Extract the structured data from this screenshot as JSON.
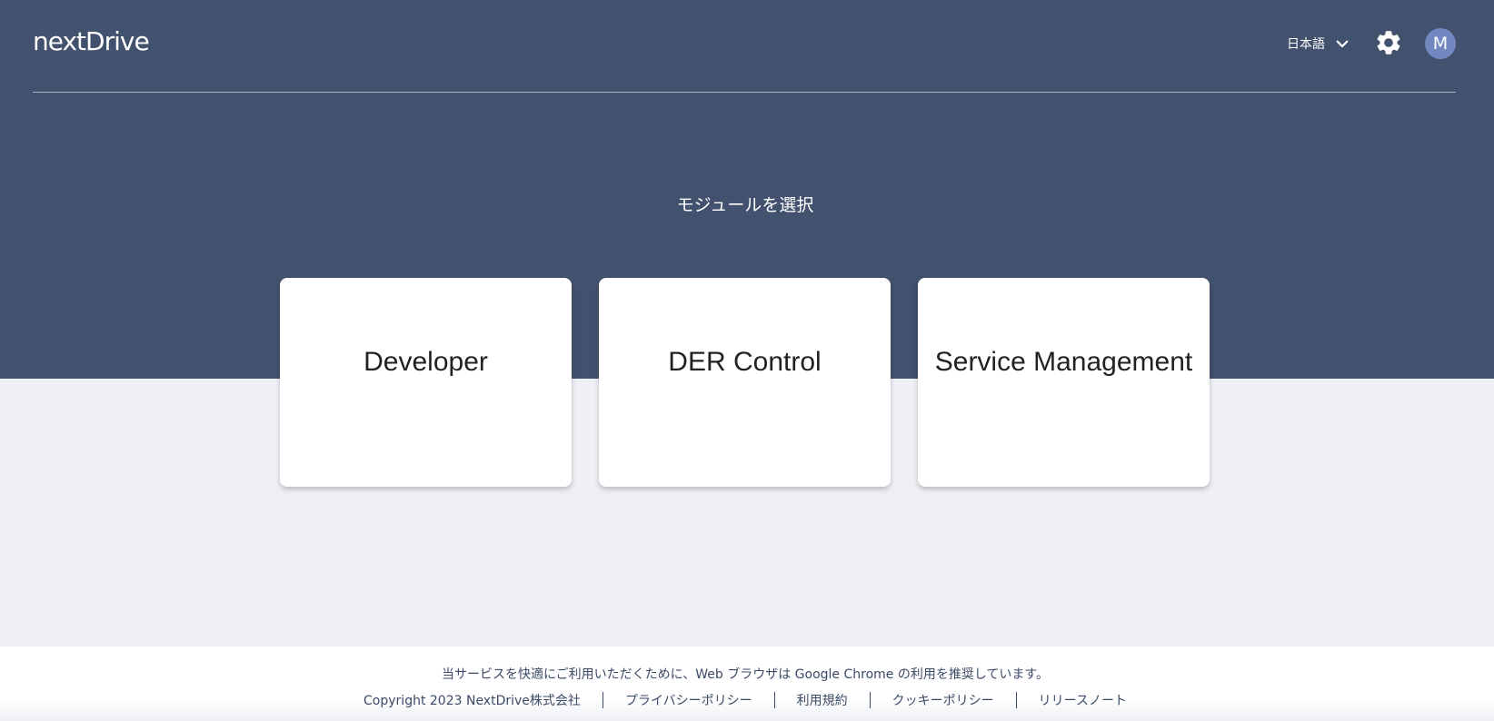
{
  "header": {
    "logo": "nextDrive",
    "language": "日本語",
    "avatar_initial": "M"
  },
  "main": {
    "title": "モジュールを選択",
    "modules": [
      {
        "label": "Developer"
      },
      {
        "label": "DER Control"
      },
      {
        "label": "Service Management"
      }
    ]
  },
  "footer": {
    "notice": "当サービスを快適にご利用いただくために、Web ブラウザは Google Chrome の利用を推奨しています。",
    "copyright": "Copyright 2023 NextDrive株式会社",
    "links": [
      "プライバシーポリシー",
      "利用規約",
      "クッキーポリシー",
      "リリースノート"
    ]
  },
  "colors": {
    "hero_bg": "#42516d",
    "page_bg": "#eef0f5",
    "avatar_bg": "#7388c0"
  },
  "icons": [
    "chevron-down-icon",
    "gear-icon"
  ]
}
